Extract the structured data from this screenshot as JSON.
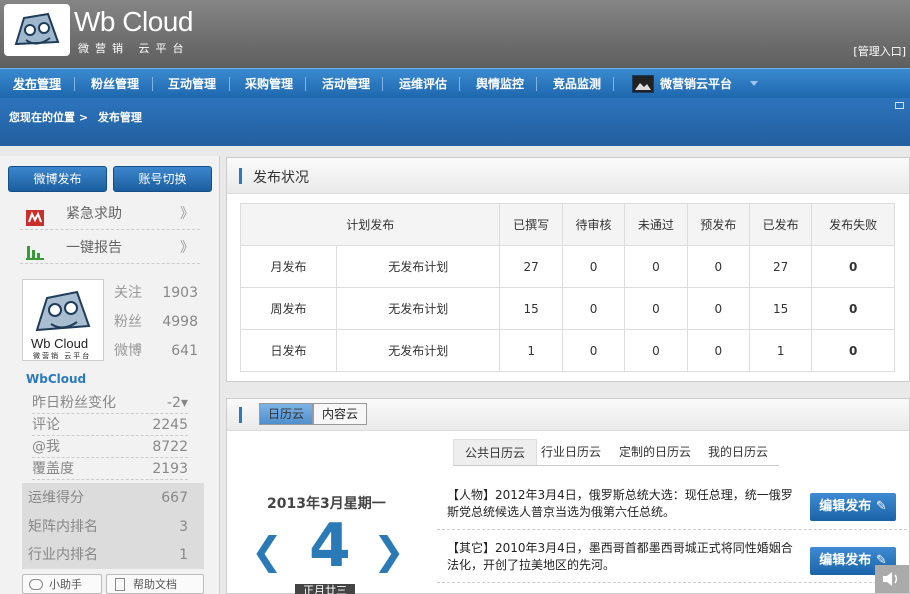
{
  "header": {
    "logo_text": "Wb Cloud",
    "logo_sub": "微营销 云平台",
    "admin_link": "[管理入口]"
  },
  "nav": {
    "items": [
      {
        "label": "发布管理"
      },
      {
        "label": "粉丝管理"
      },
      {
        "label": "互动管理"
      },
      {
        "label": "采购管理"
      },
      {
        "label": "活动管理"
      },
      {
        "label": "运维评估"
      },
      {
        "label": "舆情监控"
      },
      {
        "label": "竞品监测"
      },
      {
        "label": "微营销云平台"
      }
    ]
  },
  "breadcrumb": {
    "prefix": "您现在的位置 >",
    "current": "发布管理"
  },
  "sidebar": {
    "btn_publish": "微博发布",
    "btn_switch": "账号切换",
    "emergency": "紧急求助",
    "report": "一键报告",
    "arrow": "》",
    "avatar_text": "Wb Cloud",
    "avatar_sub": "微营销 云平台",
    "stats": [
      {
        "label": "关注",
        "value": "1903"
      },
      {
        "label": "粉丝",
        "value": "4998"
      },
      {
        "label": "微博",
        "value": "641"
      }
    ],
    "username": "WbCloud",
    "metrics": [
      {
        "label": "昨日粉丝变化",
        "value": "-2▾"
      },
      {
        "label": "评论",
        "value": "2245"
      },
      {
        "label": "@我",
        "value": "8722"
      },
      {
        "label": "覆盖度",
        "value": "2193"
      }
    ],
    "scores": [
      {
        "label": "运维得分",
        "value": "667"
      },
      {
        "label": "矩阵内排名",
        "value": "3"
      },
      {
        "label": "行业内排名",
        "value": "1"
      }
    ],
    "helper": "小助手",
    "docs": "帮助文档"
  },
  "status_panel": {
    "title": "发布状况",
    "headers": [
      "计划发布",
      "已撰写",
      "待审核",
      "未通过",
      "预发布",
      "已发布",
      "发布失败"
    ],
    "rows": [
      {
        "period": "月发布",
        "plan": "无发布计划",
        "vals": [
          "27",
          "0",
          "0",
          "0",
          "27"
        ],
        "fail": "0"
      },
      {
        "period": "周发布",
        "plan": "无发布计划",
        "vals": [
          "15",
          "0",
          "0",
          "0",
          "15"
        ],
        "fail": "0"
      },
      {
        "period": "日发布",
        "plan": "无发布计划",
        "vals": [
          "1",
          "0",
          "0",
          "0",
          "1"
        ],
        "fail": "0"
      }
    ]
  },
  "calendar_panel": {
    "tab_calendar": "日历云",
    "tab_content": "内容云",
    "subtabs": [
      "公共日历云",
      "行业日历云",
      "定制的日历云",
      "我的日历云"
    ],
    "date_title": "2013年3月星期一",
    "day": "4",
    "lunar": "正月廿三",
    "news": [
      {
        "text": "【人物】2012年3月4日，俄罗斯总统大选：现任总理，统一俄罗斯党总统候选人普京当选为俄第六任总统。"
      },
      {
        "text": "【其它】2010年3月4日，墨西哥首都墨西哥城正式将同性婚姻合法化，开创了拉美地区的先河。"
      }
    ],
    "edit_label": "编辑发布"
  }
}
